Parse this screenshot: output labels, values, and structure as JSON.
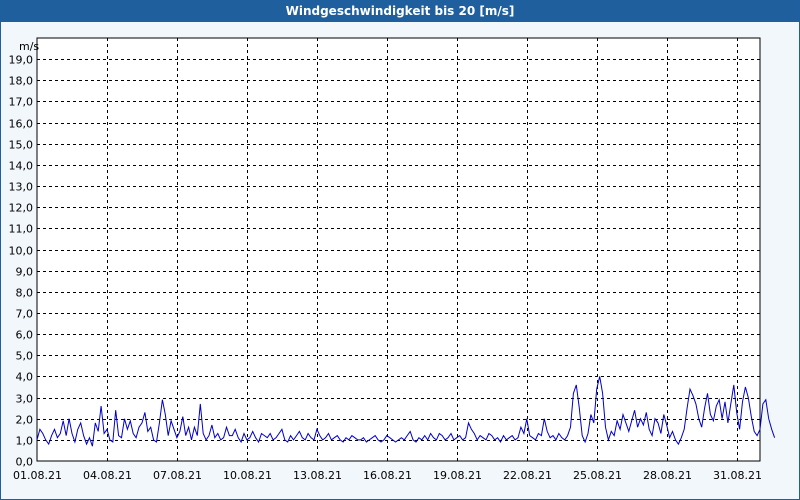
{
  "chart_data": {
    "type": "line",
    "title": "Windgeschwindigkeit bis 20 [m/s]",
    "ylabel": "m/s",
    "ylim": [
      0,
      20
    ],
    "y_ticks": [
      "0,0",
      "1,0",
      "2,0",
      "3,0",
      "4,0",
      "5,0",
      "6,0",
      "7,0",
      "8,0",
      "9,0",
      "10,0",
      "11,0",
      "12,0",
      "13,0",
      "14,0",
      "15,0",
      "16,0",
      "17,0",
      "18,0",
      "19,0"
    ],
    "x_ticks": [
      "01.08.21",
      "04.08.21",
      "07.08.21",
      "10.08.21",
      "13.08.21",
      "16.08.21",
      "19.08.21",
      "22.08.21",
      "25.08.21",
      "28.08.21",
      "31.08.21"
    ],
    "x_range_days": [
      0,
      31
    ],
    "grid": true,
    "series": [
      {
        "color": "#0000cc",
        "x_step_days": 0.125,
        "values": [
          1.0,
          1.5,
          1.3,
          1.0,
          0.8,
          1.2,
          1.5,
          1.1,
          1.3,
          1.9,
          1.2,
          2.0,
          1.3,
          0.9,
          1.5,
          1.8,
          1.2,
          0.8,
          1.1,
          0.7,
          1.8,
          1.4,
          2.6,
          1.3,
          1.5,
          1.0,
          0.9,
          2.4,
          1.2,
          1.1,
          2.0,
          1.5,
          1.9,
          1.3,
          1.1,
          1.6,
          1.8,
          2.3,
          1.4,
          1.6,
          1.0,
          0.9,
          1.8,
          2.9,
          2.2,
          1.2,
          1.9,
          1.5,
          1.1,
          1.4,
          2.1,
          1.2,
          1.6,
          1.0,
          1.6,
          1.2,
          2.7,
          1.3,
          1.0,
          1.2,
          1.7,
          1.1,
          1.3,
          1.0,
          1.1,
          1.6,
          1.2,
          1.2,
          1.5,
          1.1,
          0.9,
          1.3,
          1.0,
          1.1,
          1.4,
          1.1,
          0.9,
          1.3,
          1.2,
          1.1,
          1.3,
          1.0,
          1.1,
          1.3,
          1.5,
          1.0,
          0.9,
          1.2,
          1.0,
          1.2,
          1.4,
          1.1,
          1.0,
          1.3,
          1.1,
          1.0,
          1.5,
          1.2,
          1.0,
          1.1,
          1.3,
          1.0,
          1.1,
          1.2,
          1.0,
          0.9,
          1.1,
          1.0,
          1.2,
          1.1,
          1.0,
          1.0,
          1.1,
          0.9,
          1.0,
          1.1,
          1.2,
          1.0,
          0.9,
          1.0,
          1.2,
          1.1,
          1.0,
          0.9,
          1.0,
          1.1,
          1.0,
          1.2,
          1.4,
          1.0,
          0.9,
          1.1,
          1.0,
          1.2,
          1.0,
          1.3,
          1.1,
          1.0,
          1.3,
          1.2,
          1.0,
          1.1,
          1.3,
          1.0,
          1.1,
          1.2,
          1.0,
          1.1,
          1.8,
          1.5,
          1.3,
          1.0,
          1.2,
          1.1,
          1.0,
          1.3,
          1.2,
          1.0,
          1.1,
          0.9,
          1.2,
          1.0,
          1.1,
          1.2,
          1.0,
          1.1,
          1.6,
          1.3,
          2.0,
          1.2,
          1.1,
          1.0,
          1.3,
          1.2,
          2.0,
          1.4,
          1.1,
          1.2,
          1.0,
          1.3,
          1.1,
          1.0,
          1.2,
          1.6,
          3.2,
          3.6,
          2.5,
          1.2,
          0.9,
          1.3,
          2.2,
          1.8,
          3.4,
          4.0,
          3.2,
          1.6,
          1.0,
          1.4,
          1.2,
          1.9,
          1.5,
          2.2,
          1.8,
          1.4,
          1.9,
          2.4,
          1.6,
          2.0,
          1.7,
          2.3,
          1.5,
          1.2,
          2.0,
          1.8,
          1.3,
          2.2,
          1.7,
          1.1,
          1.4,
          1.0,
          0.8,
          1.1,
          1.5,
          2.5,
          3.4,
          3.1,
          2.7,
          2.0,
          1.6,
          2.5,
          3.2,
          2.2,
          1.9,
          2.6,
          2.9,
          2.0,
          2.8,
          1.8,
          2.7,
          3.6,
          2.3,
          1.5,
          2.8,
          3.5,
          3.0,
          2.1,
          1.4,
          1.2,
          1.5,
          2.7,
          2.9,
          2.0,
          1.5,
          1.1
        ]
      }
    ]
  }
}
